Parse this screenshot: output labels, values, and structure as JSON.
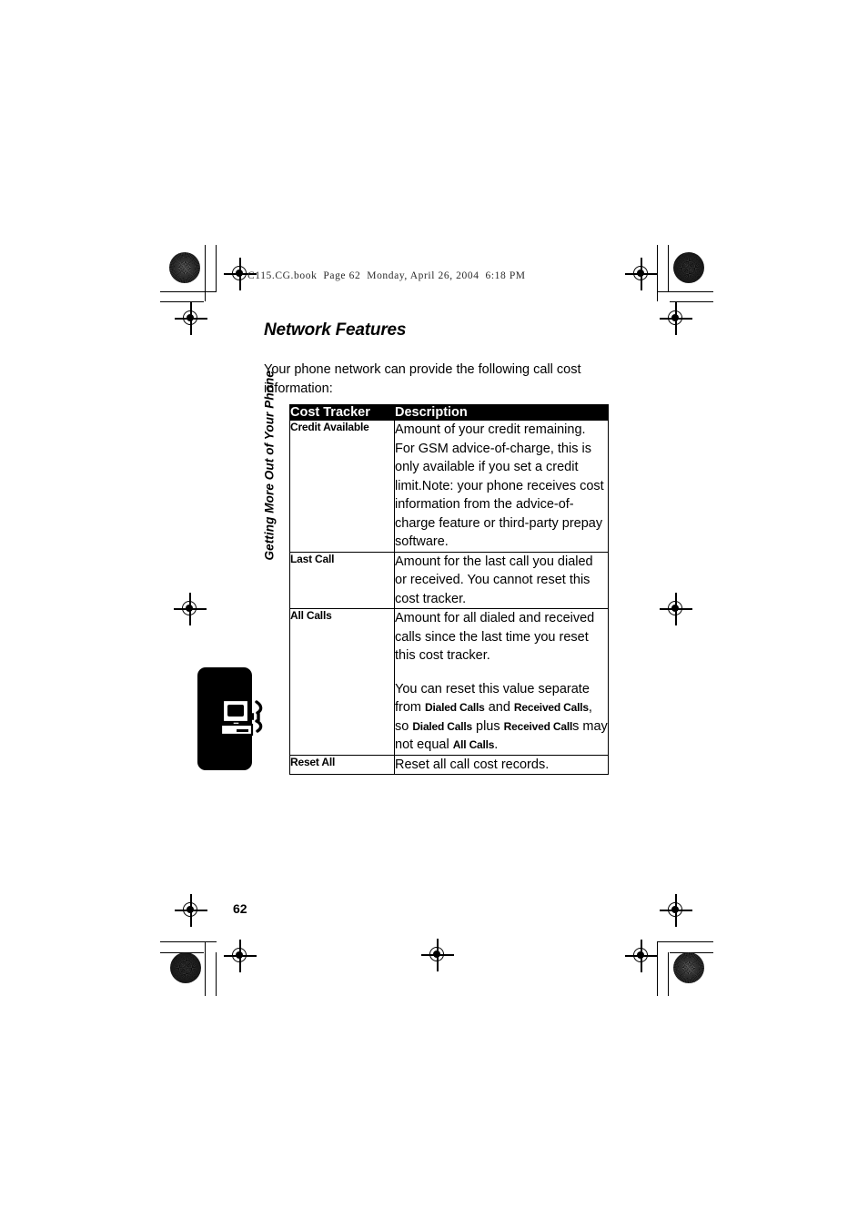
{
  "document": {
    "running_header": "C115.CG.book  Page 62  Monday, April 26, 2004  6:18 PM",
    "chapter_side_label": "Getting More Out of Your Phone",
    "page_number": "62",
    "thumb_tab_icon": "computer-phone-icon"
  },
  "section": {
    "heading": "Network Features",
    "intro": "Your phone network can provide the following call cost information:"
  },
  "table": {
    "name": "cost-tracker-table",
    "headers": {
      "term": "Cost Tracker",
      "description": "Description"
    },
    "rows": [
      {
        "term": "Credit Available",
        "paragraphs": [
          {
            "runs": [
              {
                "text": "Amount of your credit remaining. For GSM advice-of-charge, this is only available if you set a credit limit.Note: your phone receives cost information from the advice-of-charge feature or third-party prepay software.",
                "style": "normal"
              }
            ]
          }
        ]
      },
      {
        "term": "Last Call",
        "paragraphs": [
          {
            "runs": [
              {
                "text": "Amount for the last call you dialed or received. You cannot reset this cost tracker.",
                "style": "normal"
              }
            ]
          }
        ]
      },
      {
        "term": "All Calls",
        "paragraphs": [
          {
            "runs": [
              {
                "text": "Amount for all dialed and received calls since the last time you reset this cost tracker.",
                "style": "normal"
              }
            ]
          },
          {
            "runs": [
              {
                "text": "You can reset this value separate from ",
                "style": "normal"
              },
              {
                "text": "Dialed Calls",
                "style": "keyword"
              },
              {
                "text": " and ",
                "style": "normal"
              },
              {
                "text": "Received Calls",
                "style": "keyword"
              },
              {
                "text": ", so ",
                "style": "normal"
              },
              {
                "text": "Dialed Calls",
                "style": "keyword"
              },
              {
                "text": " plus ",
                "style": "normal"
              },
              {
                "text": "Received Call",
                "style": "keyword"
              },
              {
                "text": "s may not equal ",
                "style": "normal"
              },
              {
                "text": "All Calls",
                "style": "keyword"
              },
              {
                "text": ".",
                "style": "normal"
              }
            ]
          }
        ]
      },
      {
        "term": "Reset All",
        "paragraphs": [
          {
            "runs": [
              {
                "text": "Reset all call cost records.",
                "style": "normal"
              }
            ]
          }
        ]
      }
    ]
  },
  "print_marks": {
    "registration_target_icon": "registration-crosshair-icon",
    "halftone_patch_icon": "halftone-density-patch-icon",
    "crop_mark_icon": "crop-mark-icon"
  },
  "colors": {
    "ink": "#000000",
    "paper": "#ffffff",
    "header_band": "#000000",
    "header_text": "#ffffff"
  }
}
